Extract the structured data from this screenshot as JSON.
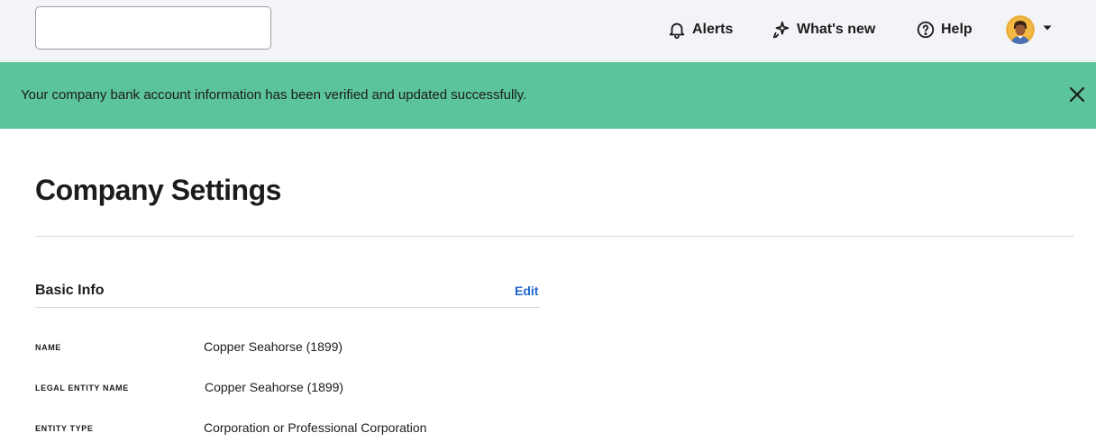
{
  "header": {
    "search": {
      "value": "",
      "placeholder": ""
    },
    "nav": {
      "alerts_label": "Alerts",
      "whats_new_label": "What's new",
      "help_label": "Help"
    },
    "icons": {
      "alerts": "bell-icon",
      "whats_new": "sparkle-icon",
      "help": "question-circle-icon",
      "profile_menu": "caret-down-icon"
    }
  },
  "banner": {
    "message": "Your company bank account information has been verified and updated successfully.",
    "close_icon": "close-icon",
    "color": "#5cc49a"
  },
  "main": {
    "title": "Company Settings",
    "sections": [
      {
        "title": "Basic Info",
        "edit_label": "Edit",
        "fields": [
          {
            "label": "NAME",
            "value": "Copper Seahorse (1899)"
          },
          {
            "label": "LEGAL ENTITY NAME",
            "value": "Copper Seahorse (1899)"
          },
          {
            "label": "ENTITY TYPE",
            "value": "Corporation or Professional Corporation"
          }
        ]
      }
    ]
  },
  "colors": {
    "topbar_bg": "#f3f4f8",
    "link": "#1f66d1",
    "text": "#1c1c1c"
  }
}
